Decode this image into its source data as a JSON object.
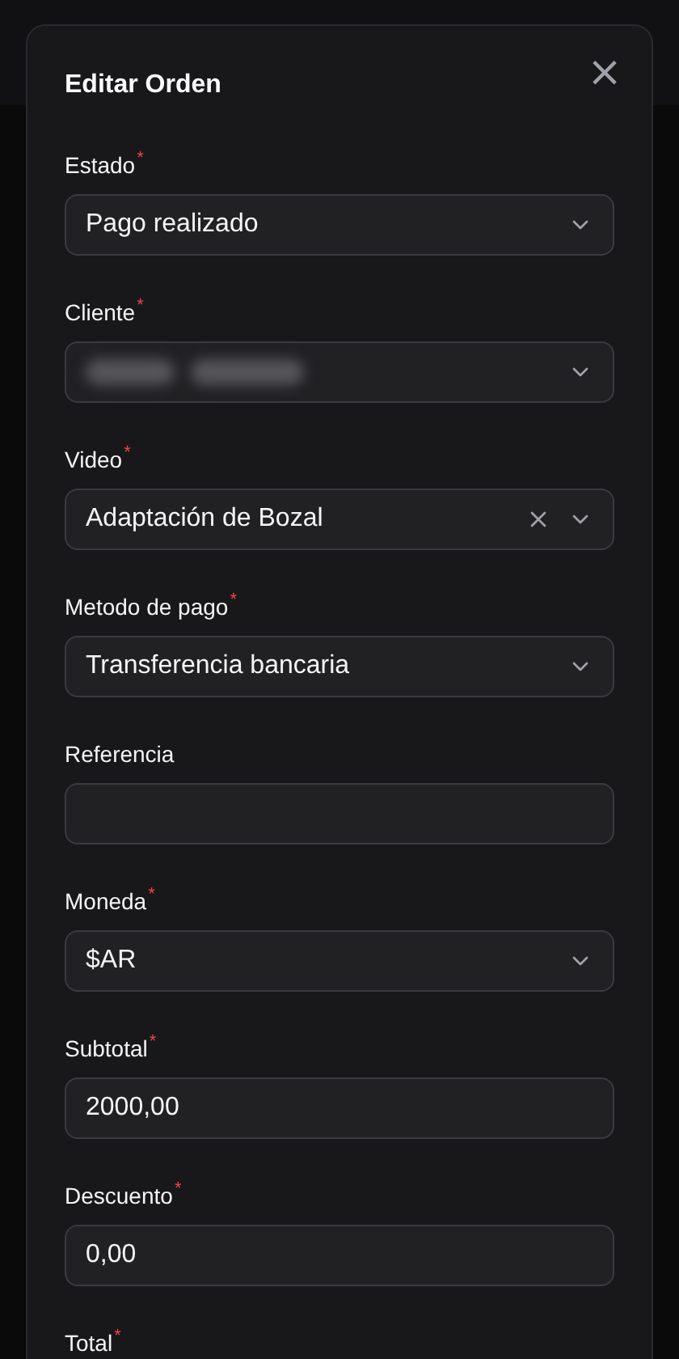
{
  "dialog": {
    "title": "Editar Orden",
    "close": "×"
  },
  "fields": [
    {
      "kind": "select",
      "label": "Estado",
      "required_mark": "*",
      "value": "Pago realizado"
    },
    {
      "kind": "select",
      "label": "Cliente",
      "required_mark": "*",
      "blurred": true
    },
    {
      "kind": "select",
      "label": "Video",
      "required_mark": "*",
      "value": "Adaptación de Bozal",
      "clearable": true
    },
    {
      "kind": "select",
      "label": "Metodo de pago",
      "required_mark": "*",
      "value": "Transferencia bancaria"
    },
    {
      "kind": "text",
      "label": "Referencia"
    },
    {
      "kind": "select",
      "label": "Moneda",
      "required_mark": "*",
      "value": "$AR"
    },
    {
      "kind": "text",
      "label": "Subtotal",
      "required_mark": "*",
      "value": "2000,00"
    },
    {
      "kind": "text",
      "label": "Descuento",
      "required_mark": "*",
      "value": "0,00"
    },
    {
      "label": "Total",
      "required_mark": "*"
    }
  ]
}
